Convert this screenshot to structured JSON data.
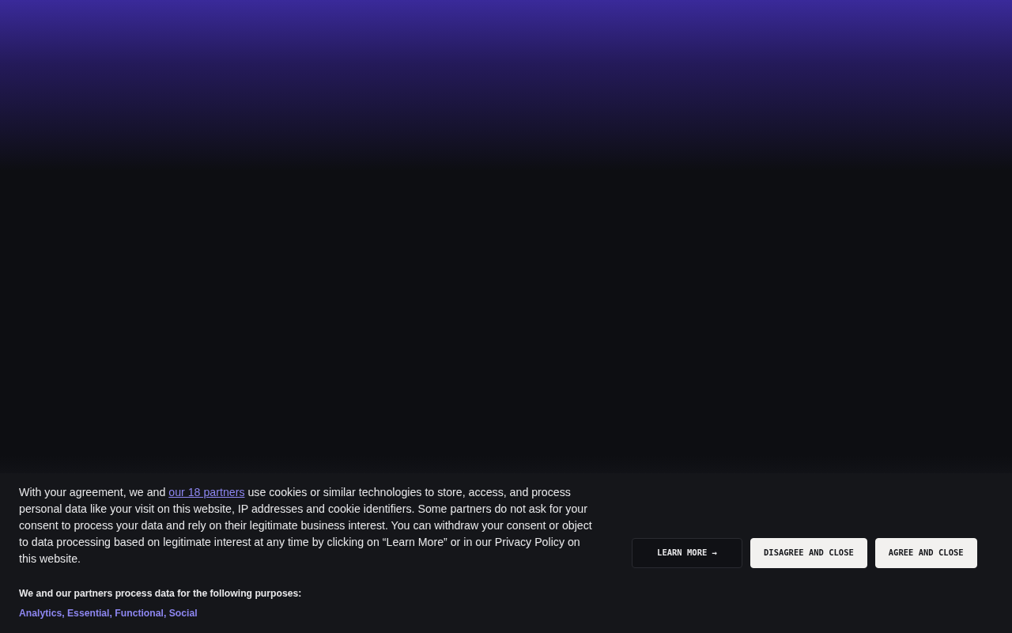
{
  "consent": {
    "text_before": "With your agreement, we and",
    "link": "our 18 partners",
    "text_after": "use cookies or similar technologies to store, access, and process personal data like your visit on this website, IP addresses and cookie identifiers. Some partners do not ask for your consent to process your data and rely on their legitimate business interest. You can withdraw your consent or object to data processing based on legitimate interest at any time by clicking on “Learn More” or in our Privacy Policy on this website.",
    "purposes_heading": "We and our partners process data for the following purposes:",
    "purposes": [
      "Analytics",
      "Essential",
      "Functional",
      "Social"
    ],
    "purpose_separator": ",",
    "buttons": [
      {
        "label": "LEARN MORE →",
        "kind": "outline"
      },
      {
        "label": "DISAGREE AND CLOSE",
        "kind": "light"
      },
      {
        "label": "AGREE AND CLOSE",
        "kind": "light"
      }
    ]
  }
}
